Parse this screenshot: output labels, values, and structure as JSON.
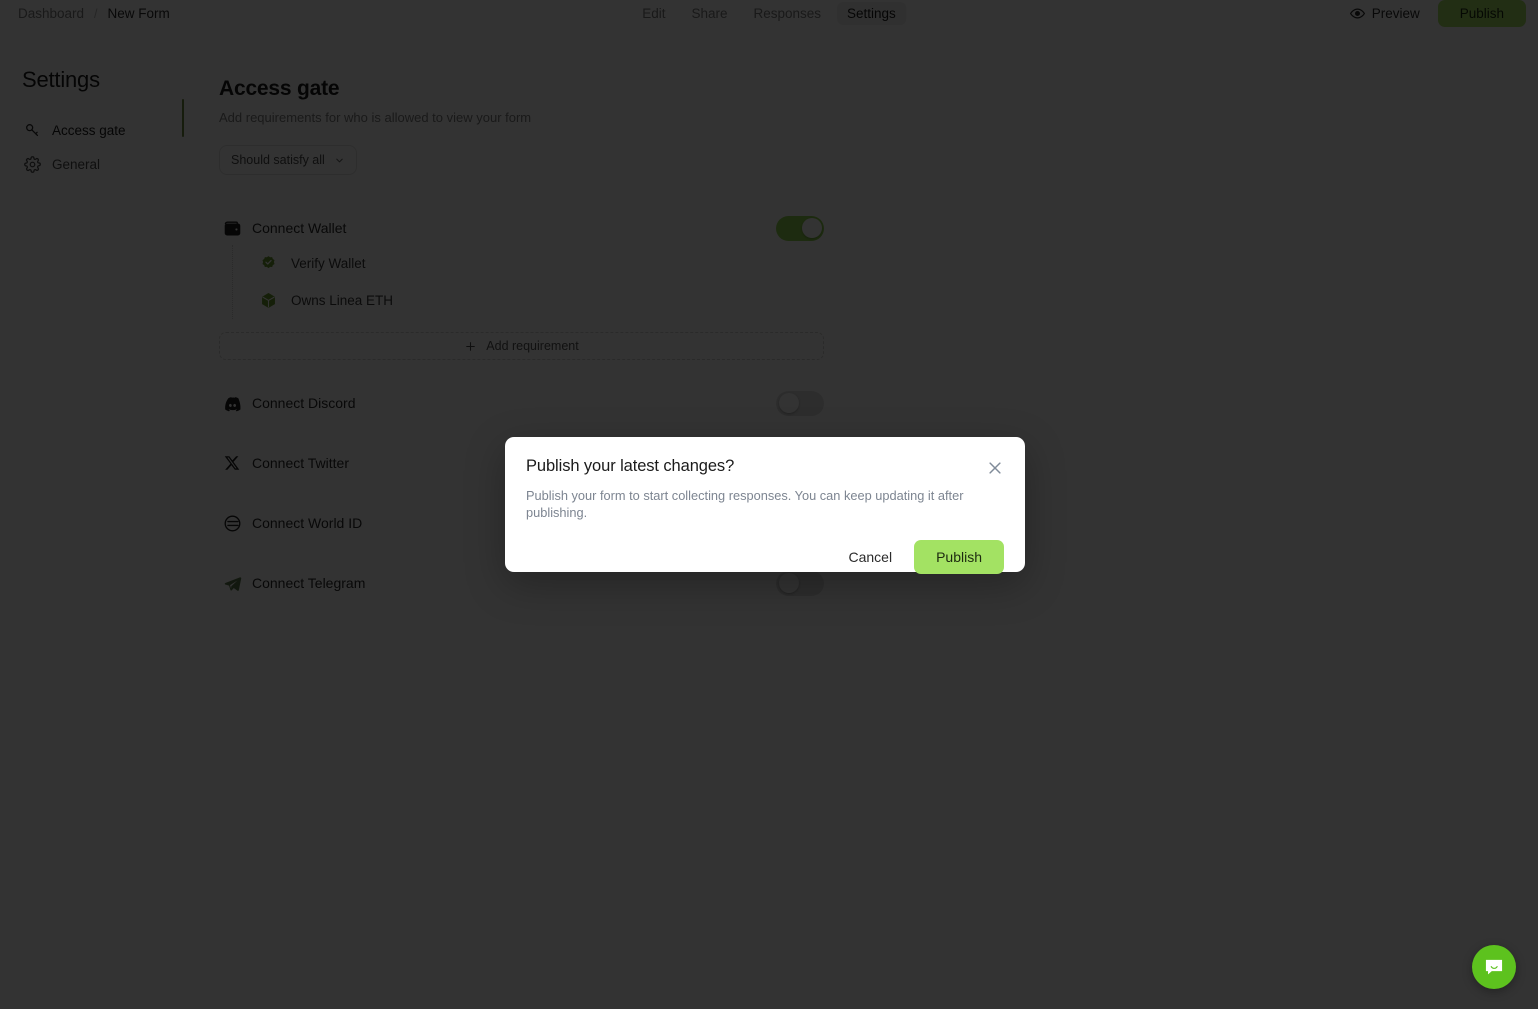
{
  "topbar": {
    "breadcrumb": {
      "root": "Dashboard",
      "separator": "/",
      "current": "New Form"
    },
    "nav": [
      {
        "label": "Edit",
        "active": false
      },
      {
        "label": "Share",
        "active": false
      },
      {
        "label": "Responses",
        "active": false
      },
      {
        "label": "Settings",
        "active": true
      }
    ],
    "preview_label": "Preview",
    "preview_icon": "eye-icon",
    "publish_label": "Publish"
  },
  "sidebar": {
    "title": "Settings",
    "items": [
      {
        "label": "Access gate",
        "icon": "key-icon",
        "active": true
      },
      {
        "label": "General",
        "icon": "gear-icon",
        "active": false
      }
    ]
  },
  "main": {
    "title": "Access gate",
    "subtitle": "Add requirements for who is allowed to view your form",
    "satisfy_select": {
      "value": "Should satisfy all",
      "icon": "chevron-down-icon"
    },
    "add_requirement_label": "Add requirement",
    "add_requirement_icon": "plus-icon",
    "requirements": [
      {
        "label": "Connect Wallet",
        "icon": "wallet-icon",
        "enabled": true,
        "sub_items": [
          {
            "label": "Verify Wallet",
            "icon": "badge-check-icon"
          },
          {
            "label": "Owns Linea ETH",
            "icon": "cube-icon"
          }
        ]
      },
      {
        "label": "Connect Discord",
        "icon": "discord-icon",
        "enabled": false,
        "sub_items": []
      },
      {
        "label": "Connect Twitter",
        "icon": "twitter-x-icon",
        "enabled": false,
        "sub_items": []
      },
      {
        "label": "Connect World ID",
        "icon": "world-id-icon",
        "enabled": false,
        "sub_items": []
      },
      {
        "label": "Connect Telegram",
        "icon": "telegram-icon",
        "enabled": false,
        "sub_items": []
      }
    ]
  },
  "modal": {
    "title": "Publish your latest changes?",
    "description": "Publish your form to start collecting responses. You can keep updating it after publishing.",
    "cancel_label": "Cancel",
    "publish_label": "Publish",
    "close_icon": "close-icon"
  },
  "chat_launcher": {
    "icon": "chat-bubble-icon"
  },
  "colors": {
    "accent_green": "#a3e263",
    "toggle_on": "#91d64f",
    "chat_green": "#5dc21e",
    "sidebar_active_bar": "#6e8b3d",
    "overlay": "rgba(0,0,0,0.80)"
  }
}
